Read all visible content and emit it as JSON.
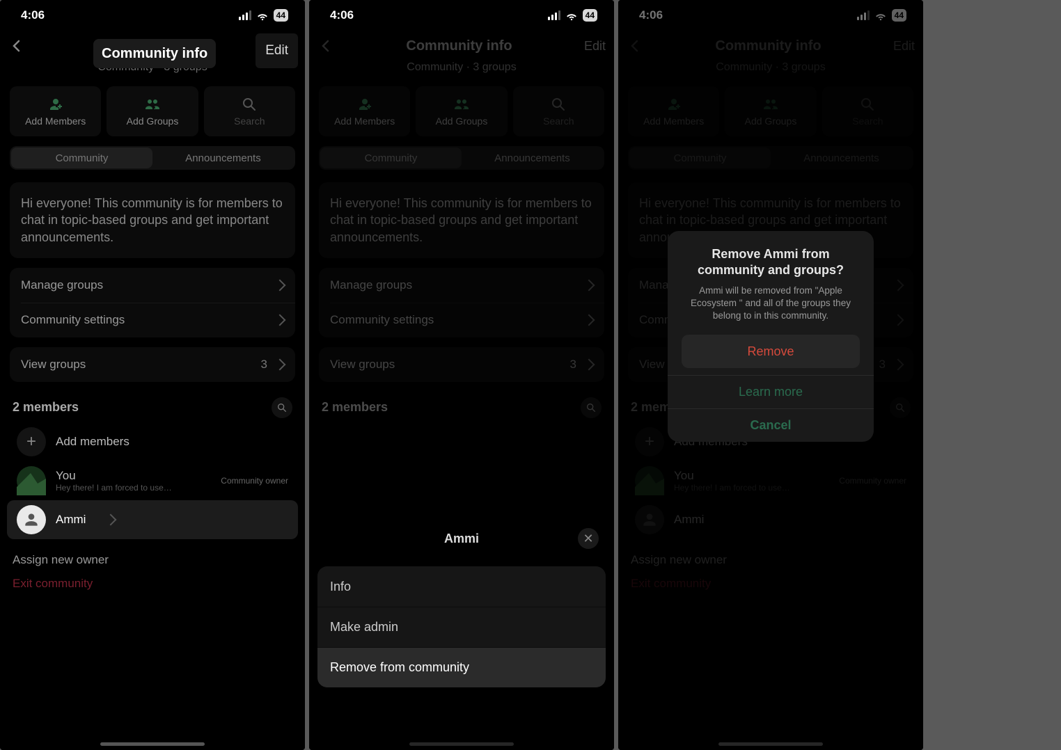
{
  "status": {
    "time": "4:06",
    "battery": "44"
  },
  "nav": {
    "title": "Community info",
    "edit": "Edit",
    "subtitle": "Community · 3 groups"
  },
  "actions": {
    "add_members": "Add Members",
    "add_groups": "Add Groups",
    "search": "Search"
  },
  "seg": {
    "community": "Community",
    "announcements": "Announcements"
  },
  "description": "Hi everyone! This community is for members to chat in topic-based groups and get important announcements.",
  "settings": {
    "manage": "Manage groups",
    "community": "Community settings"
  },
  "view_groups": {
    "label": "View groups",
    "count": "3"
  },
  "members": {
    "header": "2 members",
    "add": "Add members",
    "you": {
      "name": "You",
      "status": "Hey there! I am forced to use…",
      "role": "Community owner"
    },
    "ammi": {
      "name": "Ammi"
    }
  },
  "footer": {
    "assign": "Assign new owner",
    "exit": "Exit community"
  },
  "sheet": {
    "name": "Ammi",
    "info": "Info",
    "make_admin": "Make admin",
    "remove": "Remove from community"
  },
  "alert": {
    "title": "Remove Ammi from community and groups?",
    "message": "Ammi will be removed from \"Apple Ecosystem \" and all of the groups they belong to in this community.",
    "remove": "Remove",
    "learn": "Learn more",
    "cancel": "Cancel"
  }
}
